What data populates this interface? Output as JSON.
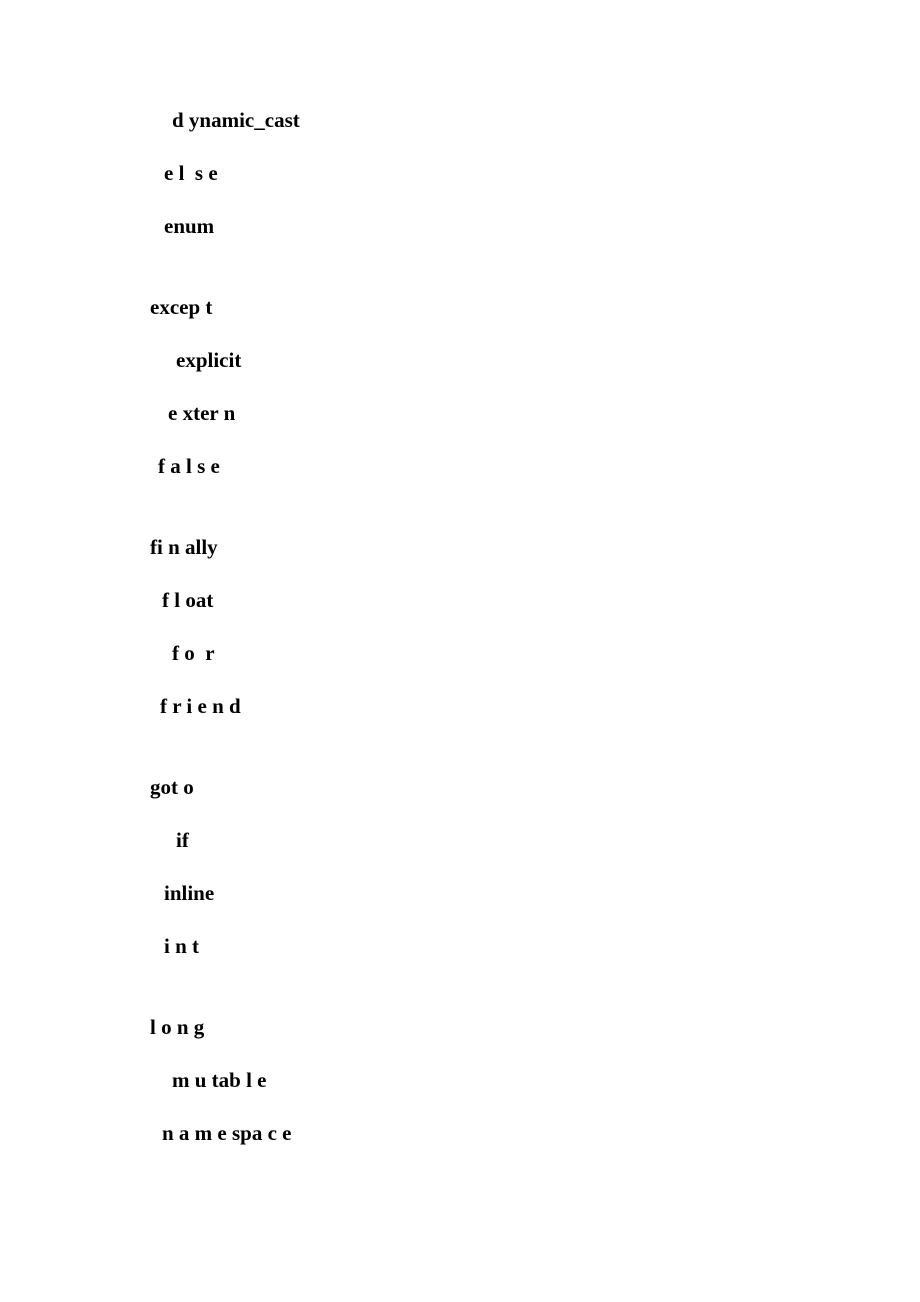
{
  "groups": [
    {
      "items": [
        {
          "indent": 22,
          "text": "d ynamic_cast"
        },
        {
          "indent": 14,
          "text": "e l  s e"
        },
        {
          "indent": 14,
          "text": "enum"
        }
      ]
    },
    {
      "items": [
        {
          "indent": 0,
          "text": "excep t"
        },
        {
          "indent": 26,
          "text": "explicit"
        },
        {
          "indent": 18,
          "text": "e xter n"
        },
        {
          "indent": 8,
          "text": "f a l s e"
        }
      ]
    },
    {
      "items": [
        {
          "indent": 0,
          "text": "fi n ally"
        },
        {
          "indent": 12,
          "text": "f l oat"
        },
        {
          "indent": 22,
          "text": "f o  r"
        },
        {
          "indent": 10,
          "text": "f r i e n d"
        }
      ]
    },
    {
      "items": [
        {
          "indent": 0,
          "text": "got o"
        },
        {
          "indent": 26,
          "text": "if"
        },
        {
          "indent": 14,
          "text": "inline"
        },
        {
          "indent": 14,
          "text": "i n t"
        }
      ]
    },
    {
      "items": [
        {
          "indent": 0,
          "text": "l o n g"
        },
        {
          "indent": 22,
          "text": "m u tab l e"
        },
        {
          "indent": 12,
          "text": "n a m e spa c e"
        }
      ]
    }
  ]
}
